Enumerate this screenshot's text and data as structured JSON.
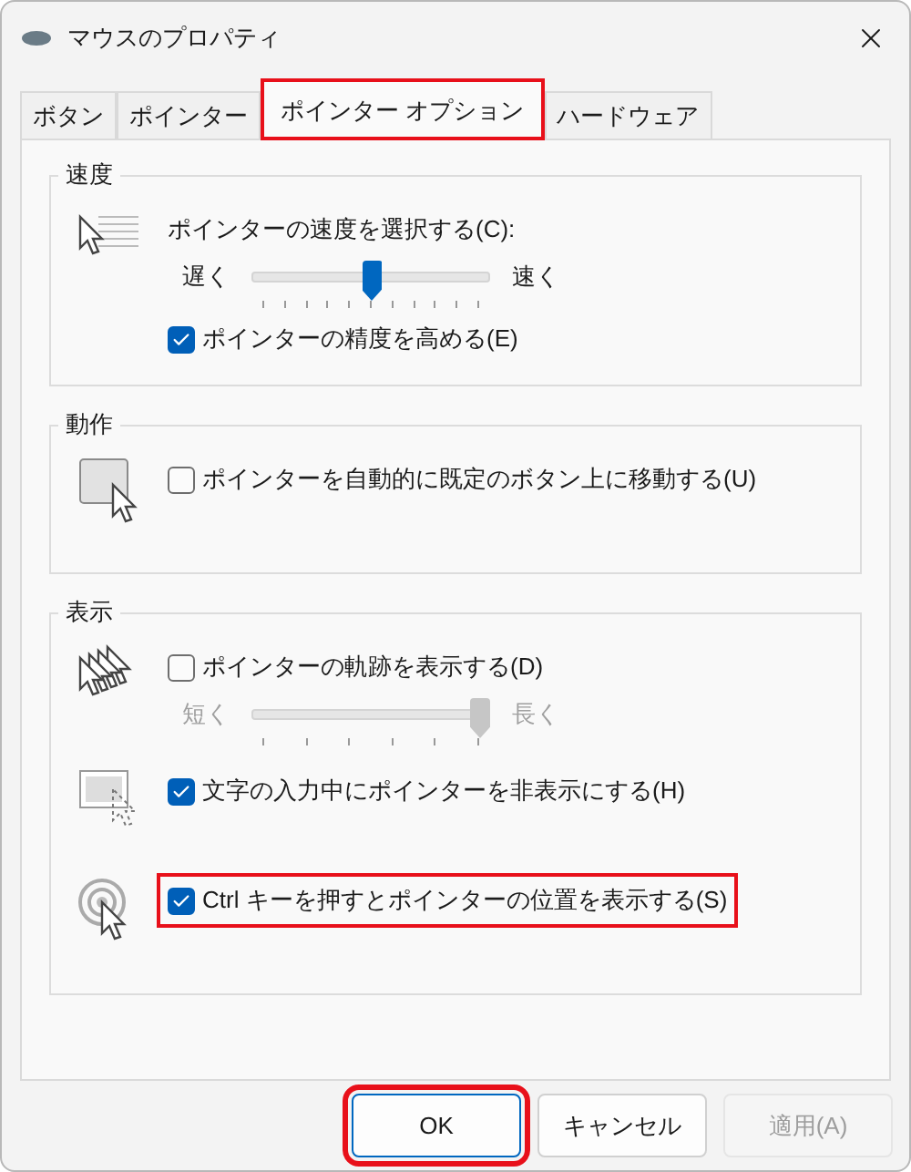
{
  "window": {
    "title": "マウスのプロパティ"
  },
  "tabs": [
    {
      "label": "ボタン",
      "selected": false,
      "highlighted": false
    },
    {
      "label": "ポインター",
      "selected": false,
      "highlighted": false
    },
    {
      "label": "ポインター オプション",
      "selected": true,
      "highlighted": true
    },
    {
      "label": "ハードウェア",
      "selected": false,
      "highlighted": false
    }
  ],
  "groups": [
    {
      "title": "速度",
      "blocks": [
        {
          "controls": [
            {
              "kind": "label",
              "label": "ポインターの速度を選択する(C):"
            },
            {
              "kind": "slider",
              "min_label": "遅く",
              "max_label": "速く",
              "level": 0.5,
              "disabled": false
            },
            {
              "kind": "checkbox",
              "label": "ポインターの精度を高める(E)",
              "checked": true,
              "highlighted": false
            }
          ]
        }
      ]
    },
    {
      "title": "動作",
      "blocks": [
        {
          "controls": [
            {
              "kind": "checkbox",
              "label": "ポインターを自動的に既定のボタン上に移動する(U)",
              "checked": false,
              "highlighted": false
            }
          ]
        }
      ]
    },
    {
      "title": "表示",
      "blocks": [
        {
          "controls": [
            {
              "kind": "checkbox",
              "label": "ポインターの軌跡を表示する(D)",
              "checked": false,
              "highlighted": false
            },
            {
              "kind": "slider",
              "min_label": "短く",
              "max_label": "長く",
              "level": 1,
              "disabled": true
            }
          ]
        },
        {
          "controls": [
            {
              "kind": "checkbox",
              "label": "文字の入力中にポインターを非表示にする(H)",
              "checked": true,
              "highlighted": false
            }
          ]
        },
        {
          "controls": [
            {
              "kind": "checkbox",
              "label": "Ctrl キーを押すとポインターの位置を表示する(S)",
              "checked": true,
              "highlighted": true
            }
          ]
        }
      ]
    }
  ],
  "buttons": [
    {
      "label": "OK",
      "default": true,
      "disabled": false,
      "highlighted": true
    },
    {
      "label": "キャンセル",
      "default": false,
      "disabled": false,
      "highlighted": false
    },
    {
      "label": "適用(A)",
      "default": false,
      "disabled": true,
      "highlighted": false
    }
  ]
}
